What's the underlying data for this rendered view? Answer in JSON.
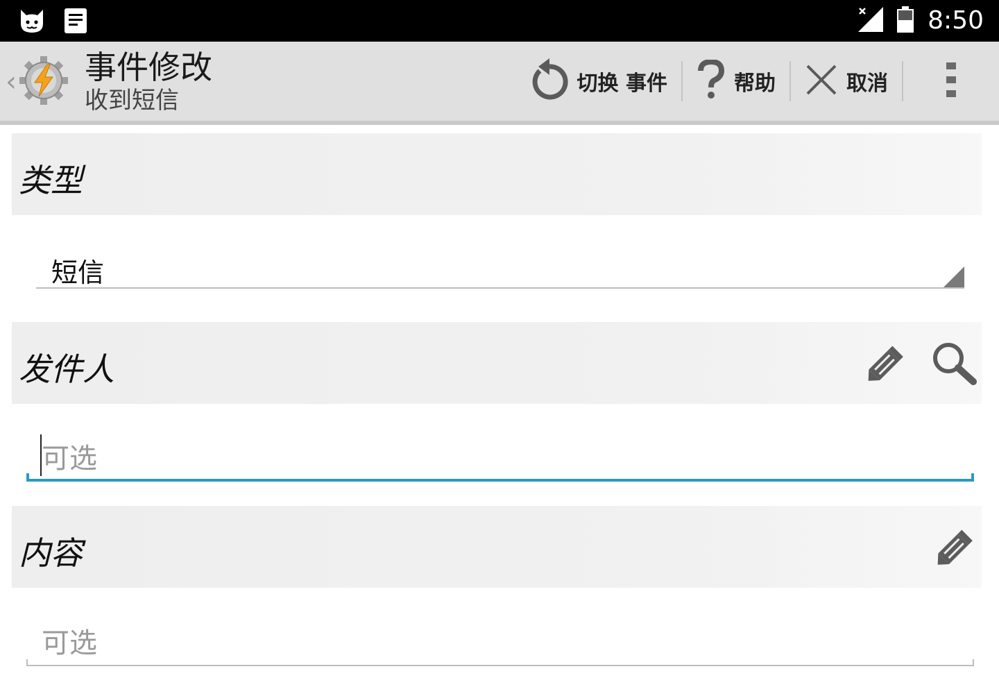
{
  "status_bar": {
    "time": "8:50"
  },
  "action_bar": {
    "title": "事件修改",
    "subtitle": "收到短信",
    "actions": [
      {
        "label": "切换 事件"
      },
      {
        "label": "帮助"
      },
      {
        "label": "取消"
      }
    ]
  },
  "sections": {
    "type": {
      "title": "类型",
      "selected": "短信"
    },
    "sender": {
      "title": "发件人",
      "placeholder": "可选"
    },
    "content": {
      "title": "内容",
      "placeholder": "可选"
    }
  },
  "colors": {
    "accent": "#2a9bbf",
    "action_bar": "#e0e0e0",
    "section_bg": "#efefef"
  }
}
